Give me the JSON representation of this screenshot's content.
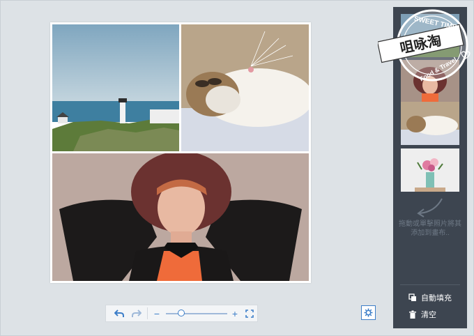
{
  "toolbar": {
    "undo_icon": "undo-arrow-icon",
    "redo_icon": "redo-arrow-icon",
    "zoom_out_label": "−",
    "zoom_in_label": "+",
    "zoom_level": 0.25,
    "fit_icon": "fit-screen-icon",
    "settings_icon": "gear-icon"
  },
  "collage": {
    "cells": [
      {
        "subject": "lighthouse-coast-photo"
      },
      {
        "subject": "sleeping-cat-photo"
      },
      {
        "subject": "woman-in-hat-photo"
      }
    ]
  },
  "sidebar": {
    "drop_hint": "拖動或單擊照片將其添加到畫布..",
    "autofill_label": "自動填充",
    "clear_label": "清空"
  },
  "watermark": {
    "line1": "SWEET TIME",
    "line2": "咀咏淘",
    "line3": "Food & Travel"
  },
  "colors": {
    "accent": "#3c7ec8",
    "sidebar_bg": "#3d4550",
    "canvas_bg": "#dde2e6"
  }
}
